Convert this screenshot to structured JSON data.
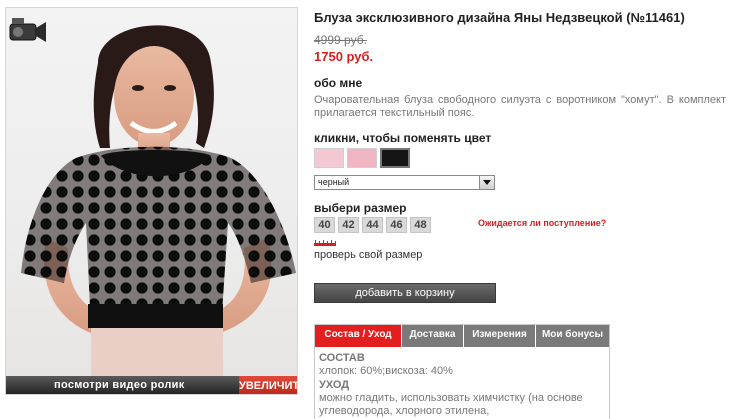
{
  "product": {
    "title": "Блуза эксклюзивного дизайна Яны Недзвецкой (№11461)",
    "old_price": "4999 руб.",
    "new_price": "1750 руб."
  },
  "about": {
    "heading": "обо мне",
    "description": "Очаровательная блуза свободного силуэта с воротником \"хомут\". В комплект прилагается текстильный пояс."
  },
  "color": {
    "heading": "кликни, чтобы поменять цвет",
    "swatches": [
      {
        "name": "light-pink",
        "color": "#f2c9d2"
      },
      {
        "name": "pink",
        "color": "#f1b6c4"
      },
      {
        "name": "black",
        "color": "#151515"
      }
    ],
    "selected_value": "черный"
  },
  "size": {
    "heading": "выбери размер",
    "options": [
      "40",
      "42",
      "44",
      "46",
      "48"
    ],
    "expect_link": "Ожидается ли поступление?",
    "check_size": "проверь свой размер"
  },
  "cart": {
    "add_label": "добавить в корзину"
  },
  "photo": {
    "video_label": "посмотри видео ролик",
    "zoom_label": "УВЕЛИЧИТЬ"
  },
  "tabs": [
    {
      "label": "Состав / Уход",
      "active": true
    },
    {
      "label": "Доставка",
      "active": false
    },
    {
      "label": "Измерения",
      "active": false
    },
    {
      "label": "Мои бонусы",
      "active": false
    }
  ],
  "tab_content": {
    "composition_heading": "СОСТАВ",
    "composition": "хлопок: 60%;вискоза: 40%",
    "care_heading": "УХОД",
    "care_line1": "можно гладить, использовать химчистку (на основе",
    "care_line2": "углеводорода, хлорного этилена,"
  },
  "colors": {
    "accent_red": "#d81e1e",
    "button_gray": "#555555"
  }
}
